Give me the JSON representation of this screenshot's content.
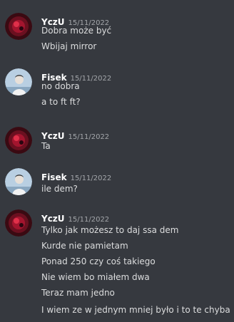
{
  "messages": [
    {
      "author": "YczU",
      "avatar_icon": "dark-red-circular-avatar-icon",
      "timestamp": "15/11/2022",
      "lines": [
        "Dobra może być",
        "Wbijaj mirror"
      ]
    },
    {
      "author": "Fisek",
      "avatar_icon": "light-blue-portrait-avatar-icon",
      "timestamp": "15/11/2022",
      "lines": [
        "no dobra",
        "a to ft ft?"
      ]
    },
    {
      "author": "YczU",
      "avatar_icon": "dark-red-circular-avatar-icon",
      "timestamp": "15/11/2022",
      "lines": [
        "Ta"
      ]
    },
    {
      "author": "Fisek",
      "avatar_icon": "light-blue-portrait-avatar-icon",
      "timestamp": "15/11/2022",
      "lines": [
        "ile dem?"
      ]
    },
    {
      "author": "YczU",
      "avatar_icon": "dark-red-circular-avatar-icon",
      "timestamp": "15/11/2022",
      "lines": [
        "Tylko jak możesz to daj ssa dem",
        "Kurde nie pamietam",
        "Ponad 250 czy coś takiego",
        "Nie wiem bo miałem dwa",
        "Teraz mam jedno",
        "I wiem ze w jednym mniej było i to te chyba"
      ]
    }
  ],
  "colors": {
    "background": "#36393f",
    "author": "#ffffff",
    "timestamp": "#a3a6aa",
    "text": "#dcddde"
  }
}
